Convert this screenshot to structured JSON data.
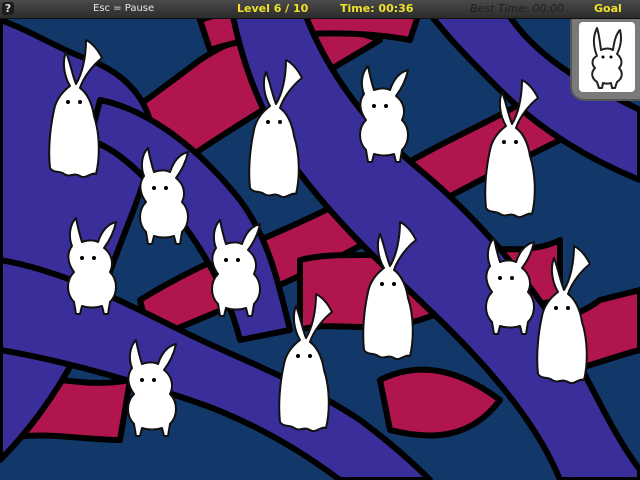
{
  "hud": {
    "help_symbol": "?",
    "pause_hint": "Esc = Pause",
    "level": "Level 6 / 10",
    "time": "Time: 00:36",
    "best_time": "Best Time:  00:00",
    "goal_label": "Goal"
  },
  "colors": {
    "background_blue": "#12386a",
    "stream_purple": "#3a2f9a",
    "stream_red": "#b0154e",
    "outline": "#000000",
    "creature": "#ffffff",
    "hud_yellow": "#f0e22a"
  },
  "creatures": [
    {
      "name": "creature-1",
      "type": "long-eared"
    },
    {
      "name": "creature-2",
      "type": "long-eared"
    },
    {
      "name": "creature-3",
      "type": "round-bodied"
    },
    {
      "name": "creature-4",
      "type": "long-eared"
    },
    {
      "name": "creature-5",
      "type": "round-bodied"
    },
    {
      "name": "creature-6",
      "type": "round-bodied"
    },
    {
      "name": "creature-7",
      "type": "long-eared"
    },
    {
      "name": "creature-8",
      "type": "round-bodied"
    },
    {
      "name": "creature-9",
      "type": "long-eared"
    },
    {
      "name": "creature-10",
      "type": "round-bodied"
    },
    {
      "name": "creature-11",
      "type": "long-eared"
    },
    {
      "name": "creature-12",
      "type": "long-eared"
    },
    {
      "name": "creature-13",
      "type": "long-eared"
    },
    {
      "name": "creature-14",
      "type": "round-bodied"
    }
  ],
  "goal_creature": {
    "name": "goal-creature",
    "type": "round-bodied"
  }
}
